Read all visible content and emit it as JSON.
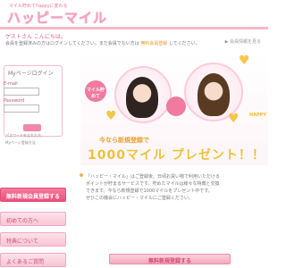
{
  "header": {
    "tagline": "マイル貯めてhappyに変わる",
    "logo": "ハッピーマイル"
  },
  "welcome": "ゲストさん こんにちは。",
  "notice": {
    "line1": "会員を登録済みの方はログインしてください。まだ会員でない方は ",
    "highlight": "無料会員登録",
    "line2": " してください。"
  },
  "profile_link": "▶ 会員情報を見る",
  "login": {
    "title": "Myページログイン",
    "email_label": "E-mail",
    "password_label": "Password",
    "email_value": "",
    "password_value": "",
    "button_label": ""
  },
  "login_links": {
    "forgot_password": "パスワードを忘れた方",
    "register": "Myページ登録方法"
  },
  "sidebar": {
    "items": [
      {
        "label": "無料新規会員登録する",
        "primary": true
      },
      {
        "label": "初めての方へ",
        "primary": false
      },
      {
        "label": "特典について",
        "primary": false
      },
      {
        "label": "よくあるご質問",
        "primary": false
      },
      {
        "label": "お問い合わせ",
        "primary": false
      }
    ]
  },
  "banner": {
    "bubble_left": "マイル貯めて",
    "bubble_right": "",
    "happy": "HAPPY",
    "promo_line1": "今なら新規登録で",
    "promo_line2": "1000マイル プレゼント！！"
  },
  "description": [
    "「ハッピー・マイル」はご登録後、日頃お買い物で利用いただける",
    "ポイントが貯まるサービスです。貯めたマイルは様々な特典と交換",
    "できます。今なら新規登録で1000マイルをプレゼント中です。",
    "ぜひこの機会にハッピー・マイルにご登録ください。"
  ],
  "cta": "無料新規登録する",
  "colors": {
    "accent": "#e8507a",
    "pink_light": "#f7c6d5",
    "gold": "#f0bf3a"
  }
}
